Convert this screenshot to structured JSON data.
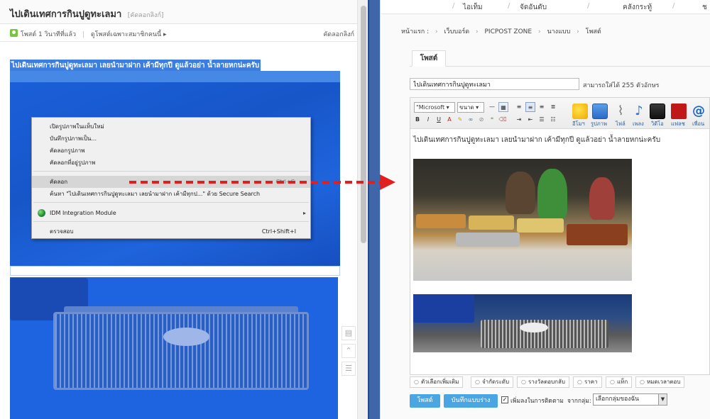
{
  "left": {
    "title": "ไปเดินเทศการกินปูดูทะเลมา",
    "title_link": "[คัดลอกลิงก์]",
    "meta": {
      "posted": "โพสต์ 1 วินาทีที่แล้ว",
      "members_only": "ดูโพสต์เฉพาะสมาชิกคนนี้ ▸",
      "copy_link": "คัดลอกลิงก์"
    },
    "selected_headline": "ไปเดินเทศการกินปูดูทะเลมา เลยนำมาฝาก เค้ามีทุกปี ดูแล้วอย่า น้ำลายหกน่ะครับ"
  },
  "context_menu": {
    "items": [
      "เปิดรูปภาพในแท็บใหม่",
      "บันทึกรูปภาพเป็น...",
      "คัดลอกรูปภาพ",
      "คัดลอกที่อยู่รูปภาพ",
      "คัดลอก",
      "ค้นหา \"ไปเดินเทศการกินปูดูทะเลมา เลยนำมาฝาก เค้ามีทุกป...\" ด้วย Secure Search",
      "IDM Integration Module",
      "ตรวจสอบ"
    ],
    "copy_shortcut": "Ctrl+C",
    "inspect_shortcut": "Ctrl+Shift+I",
    "submenu_arrow": "▸"
  },
  "right": {
    "nav": [
      "ไอเท็ม",
      "จัดอันดับ",
      "คลังกระทู้",
      "ช"
    ],
    "breadcrumb": [
      "หน้าแรก :",
      "เว็บบอร์ด",
      "PICPOST ZONE",
      "นางแบบ",
      "โพสต์"
    ],
    "tab": "โพสต์",
    "title_value": "ไปเดินเทศการกินปูดูทะเลมา",
    "title_hint": "สามารถใส่ได้ 255 ตัวอักษร",
    "toolbar": {
      "font": "Microsoft",
      "size": "ขนาด",
      "big_buttons": [
        "อีโมฯ",
        "รูปภาพ",
        "ไฟล์",
        "เพลง",
        "วิดีโอ",
        "แฟลช",
        "เพื่อน"
      ]
    },
    "editor_text": "ไปเดินเทศการกินปูดูทะเลมา เลยนำมาฝาก เค้ามีทุกปี ดูแล้วอย่า น้ำลายหกน่ะครับ",
    "tags": [
      "ตัวเลือกเพิ่มเติม",
      "จำกัดระดับ",
      "รางวัลตอบกลับ",
      "ราคา",
      "แท็ก",
      "หมดเวลาตอบ"
    ],
    "post_button": "โพสต์",
    "draft_button": "บันทึกแบบร่าง",
    "follow_label": "เพิ่มลงในการติดตาม",
    "group_label": "จากกลุ่ม:",
    "group_select": "เลือกกลุ่มของฉัน"
  },
  "colors": {
    "selection": "#1560e8",
    "divider": "#3e66a8",
    "arrow": "#e21f1f",
    "button": "#4aa6e3"
  }
}
